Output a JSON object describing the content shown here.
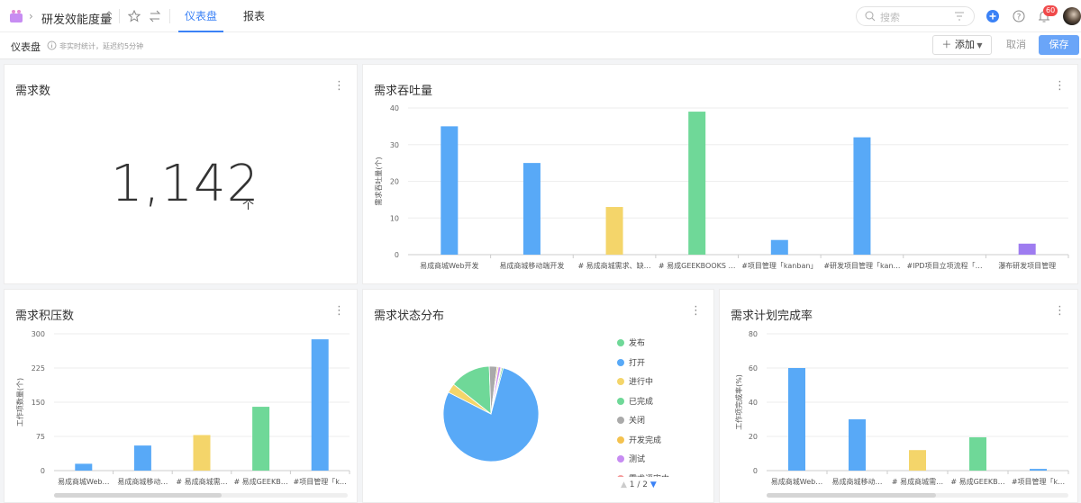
{
  "header": {
    "project_title": "研发效能度量",
    "tabs": [
      {
        "label": "仪表盘",
        "active": true
      },
      {
        "label": "报表",
        "active": false
      }
    ],
    "search_placeholder": "搜索",
    "notification_count": "60",
    "accent": "#3b82f6"
  },
  "subbar": {
    "title": "仪表盘",
    "hint": "非实时统计，延迟约5分钟",
    "add_label": "添加",
    "cancel_label": "取消",
    "save_label": "保存"
  },
  "cards": {
    "demand_count": {
      "title": "需求数",
      "value": "1,142",
      "unit": "个"
    },
    "throughput": {
      "title": "需求吞吐量"
    },
    "backlog": {
      "title": "需求积压数"
    },
    "status_dist": {
      "title": "需求状态分布",
      "pager": "1 / 2"
    },
    "completion": {
      "title": "需求计划完成率"
    }
  },
  "chart_data": [
    {
      "id": "throughput",
      "type": "bar",
      "ylabel": "需求吞吐量(个)",
      "ylim": [
        0,
        40
      ],
      "yticks": [
        0,
        10,
        20,
        30,
        40
      ],
      "categories": [
        "易成商城Web开发",
        "易成商城移动端开发",
        "# 易成商城需求、缺…",
        "# 易成GEEKBOOKS …",
        "#项目管理「kanban」",
        "#研发项目管理「kan…",
        "#IPD项目立项流程「…",
        "瀑布研发项目管理"
      ],
      "values": [
        35,
        25,
        13,
        39,
        4,
        32,
        0,
        3
      ],
      "colors": [
        "#58a9f7",
        "#58a9f7",
        "#f4d56a",
        "#6fd898",
        "#58a9f7",
        "#58a9f7",
        "#58a9f7",
        "#9e7cf0"
      ]
    },
    {
      "id": "backlog",
      "type": "bar",
      "ylabel": "工作项数量(个)",
      "ylim": [
        0,
        300
      ],
      "yticks": [
        0,
        75,
        150,
        225,
        300
      ],
      "categories": [
        "易成商城Web…",
        "易成商城移动…",
        "# 易成商城需…",
        "# 易成GEEKB…",
        "#项目管理「k…"
      ],
      "values": [
        15,
        55,
        78,
        140,
        288
      ],
      "colors": [
        "#58a9f7",
        "#58a9f7",
        "#f4d56a",
        "#6fd898",
        "#58a9f7"
      ]
    },
    {
      "id": "status",
      "type": "pie",
      "labels": [
        "发布",
        "打开",
        "进行中",
        "已完成",
        "关闭",
        "开发完成",
        "测试",
        "需求评审中"
      ],
      "values": [
        0.5,
        74,
        3,
        13,
        2.5,
        0.4,
        0.8,
        0.3
      ],
      "colors": [
        "#6fd898",
        "#58a9f7",
        "#f4d56a",
        "#6fd898",
        "#aaaaaa",
        "#f4c24f",
        "#c78cf2",
        "#f59a9a"
      ],
      "legend": "right"
    },
    {
      "id": "completion",
      "type": "bar",
      "ylabel": "工作项完成率(%)",
      "ylim": [
        0,
        80
      ],
      "yticks": [
        0,
        20,
        40,
        60,
        80
      ],
      "categories": [
        "易成商城Web…",
        "易成商城移动…",
        "# 易成商城需…",
        "# 易成GEEKB…",
        "#项目管理「k…"
      ],
      "values": [
        60,
        30,
        12,
        19.5,
        1
      ],
      "colors": [
        "#58a9f7",
        "#58a9f7",
        "#f4d56a",
        "#6fd898",
        "#58a9f7"
      ]
    }
  ]
}
